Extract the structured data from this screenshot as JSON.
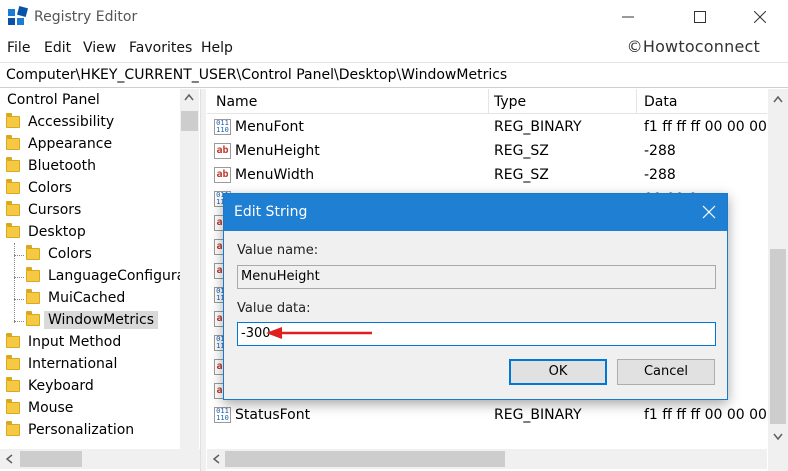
{
  "window": {
    "title": "Registry Editor",
    "watermark": "©Howtoconnect"
  },
  "menu": [
    "File",
    "Edit",
    "View",
    "Favorites",
    "Help"
  ],
  "address": "Computer\\HKEY_CURRENT_USER\\Control Panel\\Desktop\\WindowMetrics",
  "tree": {
    "root": "Control Panel",
    "items": [
      {
        "label": "Accessibility",
        "level": 0
      },
      {
        "label": "Appearance",
        "level": 0
      },
      {
        "label": "Bluetooth",
        "level": 0
      },
      {
        "label": "Colors",
        "level": 0
      },
      {
        "label": "Cursors",
        "level": 0
      },
      {
        "label": "Desktop",
        "level": 0
      },
      {
        "label": "Colors",
        "level": 1
      },
      {
        "label": "LanguageConfigurat",
        "level": 1
      },
      {
        "label": "MuiCached",
        "level": 1
      },
      {
        "label": "WindowMetrics",
        "level": 1,
        "selected": true
      },
      {
        "label": "Input Method",
        "level": 0
      },
      {
        "label": "International",
        "level": 0
      },
      {
        "label": "Keyboard",
        "level": 0
      },
      {
        "label": "Mouse",
        "level": 0
      },
      {
        "label": "Personalization",
        "level": 0
      }
    ]
  },
  "list": {
    "columns": [
      "Name",
      "Type",
      "Data"
    ],
    "rows": [
      {
        "icon": "binary-value-icon",
        "name": "MenuFont",
        "type": "REG_BINARY",
        "data": "f1 ff ff ff 00 00 00 0"
      },
      {
        "icon": "string-value-icon",
        "name": "MenuHeight",
        "type": "REG_SZ",
        "data": "-288"
      },
      {
        "icon": "string-value-icon",
        "name": "MenuWidth",
        "type": "REG_SZ",
        "data": "-288"
      },
      {
        "icon": "binary-value-icon",
        "name": "",
        "type": "",
        "data": "00 00 0"
      },
      {
        "icon": "string-value-icon",
        "name": "",
        "type": "",
        "data": ""
      },
      {
        "icon": "string-value-icon",
        "name": "",
        "type": "",
        "data": ""
      },
      {
        "icon": "string-value-icon",
        "name": "",
        "type": "",
        "data": ""
      },
      {
        "icon": "binary-value-icon",
        "name": "",
        "type": "",
        "data": ""
      },
      {
        "icon": "string-value-icon",
        "name": "",
        "type": "",
        "data": ""
      },
      {
        "icon": "binary-value-icon",
        "name": "",
        "type": "",
        "data": "00 00 0"
      },
      {
        "icon": "string-value-icon",
        "name": "",
        "type": "",
        "data": "00 00 0"
      },
      {
        "icon": "string-value-icon",
        "name": "",
        "type": "",
        "data": ""
      },
      {
        "icon": "binary-value-icon",
        "name": "StatusFont",
        "type": "REG_BINARY",
        "data": "f1 ff ff ff 00 00 00 0"
      }
    ]
  },
  "dialog": {
    "title": "Edit String",
    "value_name_label": "Value name:",
    "value_name": "MenuHeight",
    "value_data_label": "Value data:",
    "value_data": "-300",
    "ok_label": "OK",
    "cancel_label": "Cancel"
  },
  "colors": {
    "dialog_title": "#1f7fd2",
    "arrow": "#e02020",
    "folder": "#f6c945"
  }
}
